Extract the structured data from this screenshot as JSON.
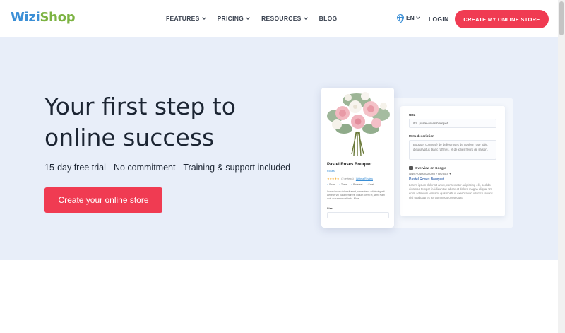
{
  "brand": {
    "part1": "Wizi",
    "part2": "Shop"
  },
  "nav": {
    "items": [
      {
        "label": "FEATURES",
        "dropdown": true
      },
      {
        "label": "PRICING",
        "dropdown": true
      },
      {
        "label": "RESOURCES",
        "dropdown": true
      },
      {
        "label": "BLOG",
        "dropdown": false
      }
    ],
    "language": "EN",
    "login": "LOGIN",
    "cta": "CREATE MY ONLINE STORE"
  },
  "hero": {
    "title": "Your first step to online success",
    "subtitle": "15-day free trial - No commitment - Training & support included",
    "button": "Create your online store"
  },
  "product_card": {
    "name": "Pastel Roses Bouquet",
    "category": "Roses",
    "rating_stars": "★★★★★",
    "reviews": "(2 reviews)",
    "write_review": "Write a Review",
    "share": [
      "Share",
      "Tweet",
      "Pinterest",
      "Email"
    ],
    "description": "Lorem ipsum dolor sit amet, consectetur adipiscing elit. Aenean vel nulla hendrerit, dictum lorem et, sem. Nam quis accumsan vehicula. More",
    "size_label": "Size",
    "size_value": "—"
  },
  "seo_panel": {
    "url_label": "URL",
    "url_value": "/fr/...pastel-roses-bouquet",
    "meta_label": "Meta description",
    "meta_value": "Bouquet composé de belles roses de couleur rose pâle, d'eucalyptus blanc raffinés, et de jolies fleurs de saison.",
    "overview_label": "Overview on Google",
    "google_url": "www.yourshop.com › ROSES ▾",
    "google_title": "Pastel Roses Bouquet",
    "google_desc": "Lorem ipsum dolor sit amet, consectetur adipiscing elit, sed do eiusmod tempor incididunt ut labore et dolore magna aliqua. Ut enim ad minim veniam, quis nostrud exercitation ullamco laboris nisi ut aliquip ex ea commodo consequat."
  },
  "colors": {
    "primary": "#f03b52",
    "hero_bg": "#e8eef9",
    "logo_blue": "#3b8fd6",
    "logo_green": "#7cb342"
  }
}
